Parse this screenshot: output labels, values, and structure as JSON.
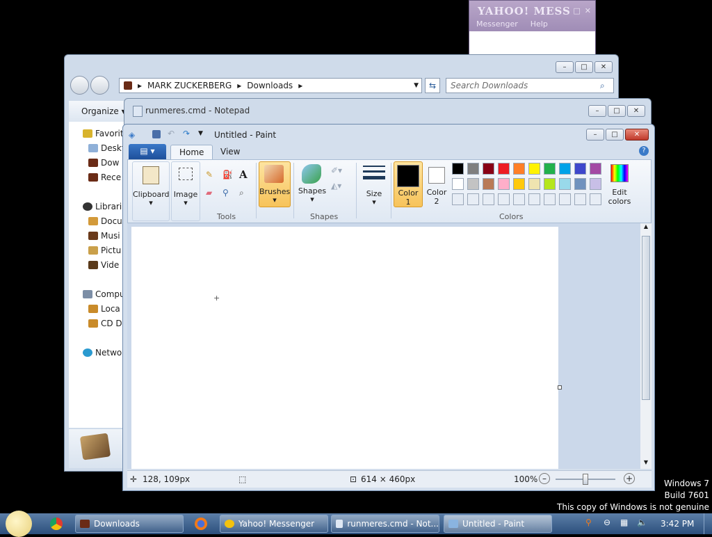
{
  "yahoo": {
    "logo": "YAHOO! MESS",
    "menu": [
      "Messenger",
      "Help"
    ]
  },
  "explorer": {
    "breadcrumb": [
      "MARK ZUCKERBERG",
      "Downloads"
    ],
    "search_placeholder": "Search Downloads",
    "organize": "Organize",
    "nav": [
      {
        "label": "Favorit",
        "color": "#d8b32c"
      },
      {
        "label": "Deskt",
        "color": "#8fb0d8"
      },
      {
        "label": "Dow",
        "color": "#6a2b16"
      },
      {
        "label": "Rece",
        "color": "#6a2b16"
      },
      {
        "label": "Librari",
        "color": "#333333"
      },
      {
        "label": "Docu",
        "color": "#d39a3a"
      },
      {
        "label": "Musi",
        "color": "#6a3a1a"
      },
      {
        "label": "Pictu",
        "color": "#caa04a"
      },
      {
        "label": "Vide",
        "color": "#5a3a1a"
      },
      {
        "label": "Compu",
        "color": "#7c8ea6"
      },
      {
        "label": "Loca",
        "color": "#c98b2a"
      },
      {
        "label": "CD D",
        "color": "#c98b2a"
      },
      {
        "label": "Netwo",
        "color": "#2a9ad0"
      }
    ]
  },
  "notepad": {
    "title": "runmeres.cmd - Notepad"
  },
  "paint": {
    "title": "Untitled - Paint",
    "tabs": {
      "home": "Home",
      "view": "View"
    },
    "ribbon": {
      "clipboard": "Clipboard",
      "image": "Image",
      "tools_group": "Tools",
      "brushes": "Brushes",
      "shapes": "Shapes",
      "shapes_group": "Shapes",
      "size": "Size",
      "color1": "Color\n1",
      "color2": "Color\n2",
      "edit_colors": "Edit\ncolors",
      "colors_group": "Colors"
    },
    "palette_row1": [
      "#000000",
      "#7f7f7f",
      "#880015",
      "#ed1c24",
      "#ff7f27",
      "#fff200",
      "#22b14c",
      "#00a2e8",
      "#3f48cc",
      "#a349a4"
    ],
    "palette_row2": [
      "#ffffff",
      "#c3c3c3",
      "#b97a57",
      "#ffaec9",
      "#ffc90e",
      "#efe4b0",
      "#b5e61d",
      "#99d9ea",
      "#7092be",
      "#c8bfe7"
    ],
    "status": {
      "cursor": "128, 109px",
      "size": "614 × 460px",
      "zoom": "100%"
    }
  },
  "taskbar": {
    "items": [
      "Downloads",
      "Yahoo! Messenger",
      "runmeres.cmd - Not...",
      "Untitled - Paint"
    ],
    "clock": "3:42 PM"
  },
  "watermark": {
    "line1": "Windows 7",
    "line2": "Build 7601",
    "line3": "This copy of Windows is not genuine"
  }
}
